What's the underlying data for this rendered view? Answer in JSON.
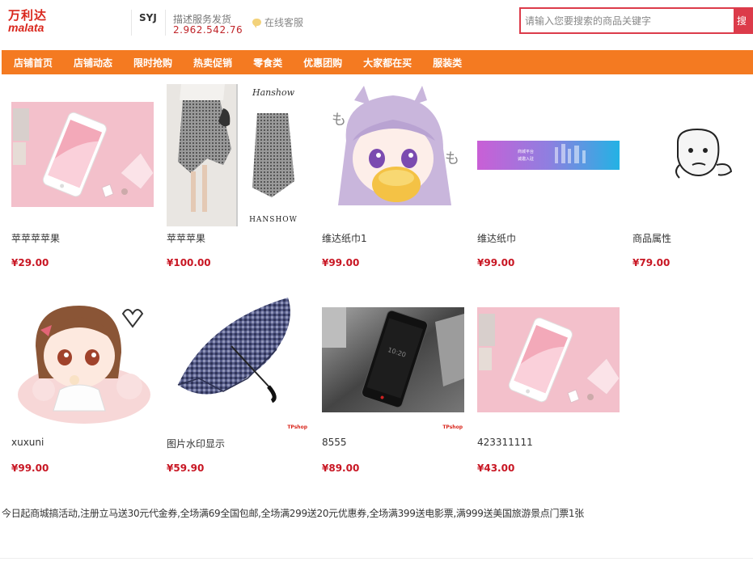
{
  "header": {
    "logo_cn": "万利达",
    "logo_en": "malata",
    "shop_name": "SYJ",
    "score_label": "描述服务发货",
    "score_values": "2.962.542.76",
    "service_label": "在线客服"
  },
  "search": {
    "placeholder": "请输入您要搜索的商品关键字",
    "button_label": "搜"
  },
  "nav": {
    "items": [
      "店铺首页",
      "店铺动态",
      "限时抢购",
      "热卖促销",
      "零食类",
      "优惠团购",
      "大家都在买",
      "服装类"
    ]
  },
  "products": [
    {
      "name": "苹苹苹苹果",
      "price": "¥29.00"
    },
    {
      "name": "苹苹苹果",
      "price": "¥100.00",
      "thumb_text_1": "Hanshow",
      "thumb_text_2": "HANSHOW"
    },
    {
      "name": "维达纸巾1",
      "price": "¥99.00"
    },
    {
      "name": "维达纸巾",
      "price": "¥99.00",
      "thumb_text_1": "商城平台",
      "thumb_text_2": "诚邀入驻"
    },
    {
      "name": "商品属性",
      "price": "¥79.00"
    },
    {
      "name": "xuxuni",
      "price": "¥99.00"
    },
    {
      "name": "图片水印显示",
      "price": "¥59.90",
      "watermark": "TPshop"
    },
    {
      "name": "8555",
      "price": "¥89.00",
      "watermark": "TPshop"
    },
    {
      "name": "423311111",
      "price": "¥43.00"
    }
  ],
  "notice": "今日起商城搞活动,注册立马送30元代金券,全场满69全国包邮,全场满299送20元优惠券,全场满399送电影票,满999送美国旅游景点门票1张"
}
